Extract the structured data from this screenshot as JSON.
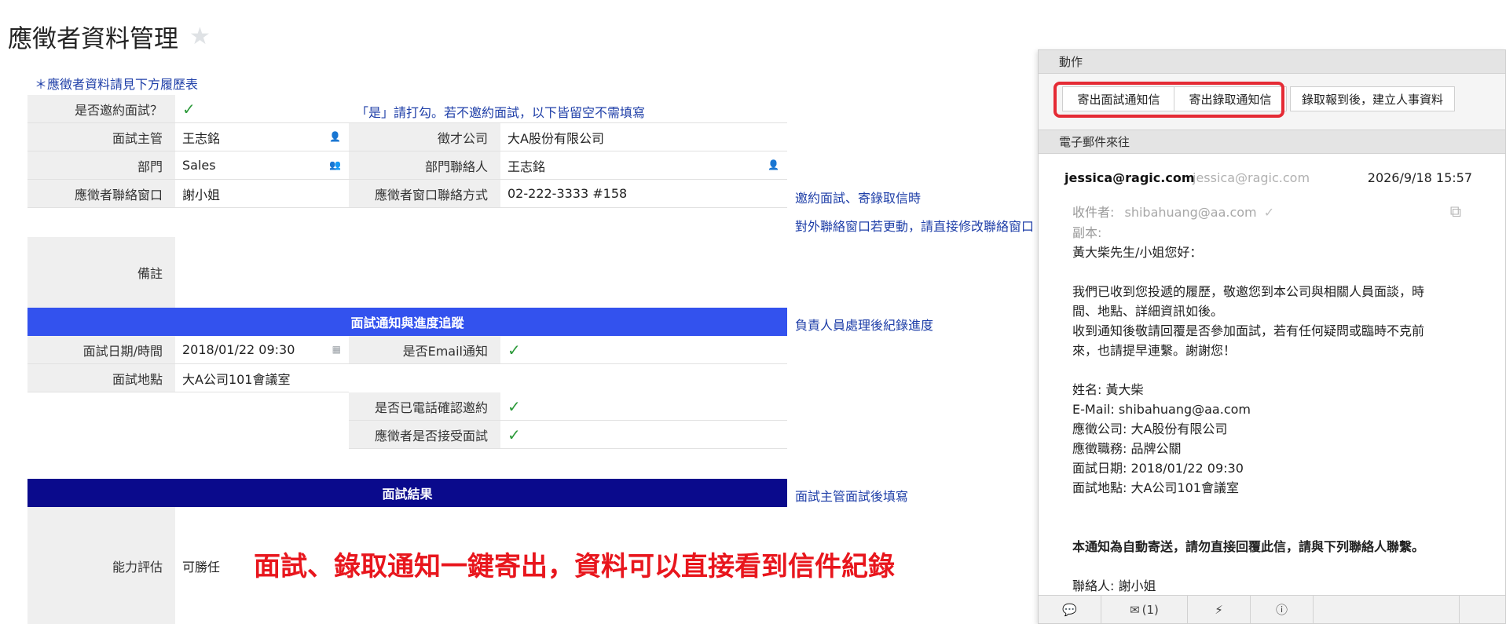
{
  "page": {
    "title": "應徵者資料管理",
    "star_icon": "star-icon",
    "note": "＊應徵者資料請見下方履歷表"
  },
  "form": {
    "invite": {
      "label": "是否邀約面試？",
      "checked": true,
      "hint": "「是」請打勾。若不邀約面試，以下皆留空不需填寫"
    },
    "interviewer": {
      "label": "面試主管",
      "value": "王志銘"
    },
    "company": {
      "label": "徵才公司",
      "value": "大A股份有限公司"
    },
    "dept": {
      "label": "部門",
      "value": "Sales"
    },
    "dept_contact": {
      "label": "部門聯絡人",
      "value": "王志銘"
    },
    "contact_window": {
      "label": "應徵者聯絡窗口",
      "value": "謝小姐"
    },
    "contact_method": {
      "label": "應徵者窗口聯絡方式",
      "value": "02-222-3333 #158"
    },
    "side_note_1": "邀約面試、寄錄取信時",
    "side_note_2": "對外聯絡窗口若更動，請直接修改聯絡窗口",
    "remarks": {
      "label": "備註",
      "value": ""
    },
    "section_progress": {
      "title": "面試通知與進度追蹤",
      "note": "負責人員處理後紀錄進度"
    },
    "interview_time": {
      "label": "面試日期/時間",
      "value": "2018/01/22 09:30"
    },
    "email_notify": {
      "label": "是否Email通知",
      "checked": true
    },
    "interview_place": {
      "label": "面試地點",
      "value": "大A公司101會議室"
    },
    "phone_confirm": {
      "label": "是否已電話確認邀約",
      "checked": true
    },
    "accept_interview": {
      "label": "應徵者是否接受面試",
      "checked": true
    },
    "section_result": {
      "title": "面試結果",
      "note": "面試主管面試後填寫"
    },
    "ability": {
      "label": "能力評估",
      "value": "可勝任"
    }
  },
  "overlay_caption": "面試、錄取通知一鍵寄出，資料可以直接看到信件紀錄",
  "panel": {
    "actions_title": "動作",
    "actions": [
      "寄出面試通知信",
      "寄出錄取通知信",
      "錄取報到後，建立人事資料"
    ],
    "emails_title": "電子郵件來往",
    "email": {
      "from": "jessica@ragic.com",
      "from_alt": "jessica@ragic.com",
      "date": "2026/9/18 15:57",
      "to_label": "收件者:",
      "to_value": "shibahuang@aa.com",
      "cc_label": "副本:",
      "body": [
        "黃大柴先生/小姐您好：",
        "",
        "我們已收到您投遞的履歷，敬邀您到本公司與相關人員面談，時",
        "間、地點、詳細資訊如後。",
        "收到通知後敬請回覆是否參加面試，若有任何疑問或臨時不克前",
        "來，也請提早連繫。謝謝您！",
        "",
        "姓名: 黃大柴",
        "E-Mail: shibahuang@aa.com",
        "應徵公司: 大A股份有限公司",
        "應徵職務: 品牌公關",
        "面試日期: 2018/01/22 09:30",
        "面試地點: 大A公司101會議室",
        "",
        "",
        "本通知為自動寄送，請勿直接回覆此信，請與下列聯絡人聯繫。",
        "",
        "聯絡人: 謝小姐"
      ]
    },
    "footer": {
      "comment_icon": "comment-icon",
      "mail_icon": "mail-icon",
      "mail_count": "(1)",
      "bolt_icon": "bolt-icon",
      "info_icon": "info-icon"
    }
  }
}
